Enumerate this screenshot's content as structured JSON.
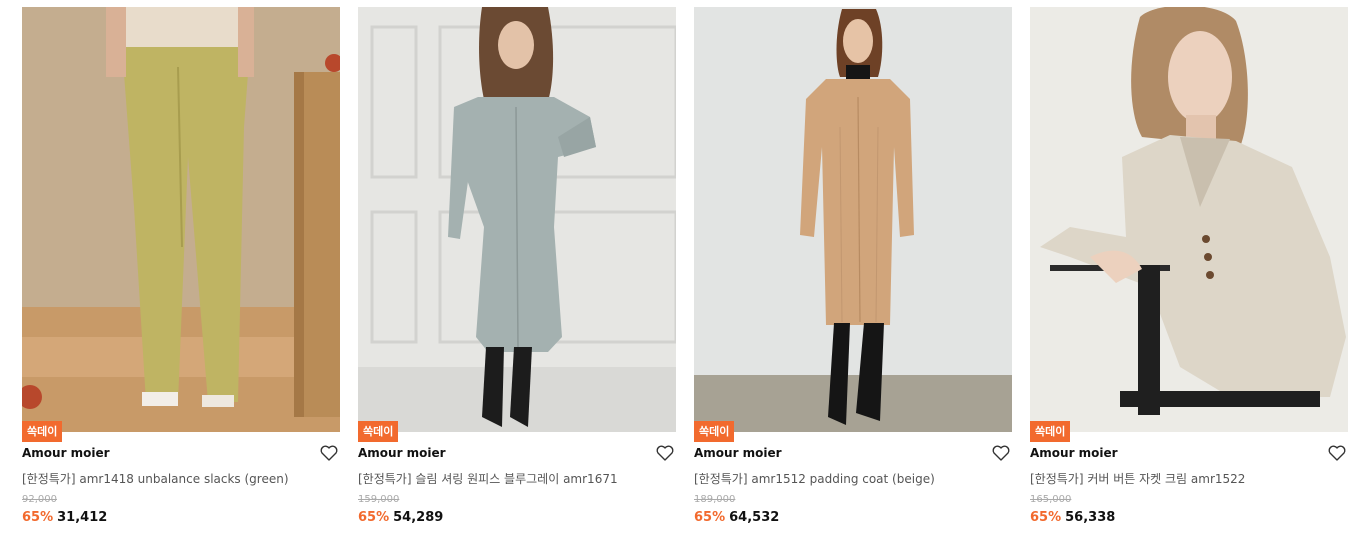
{
  "products": [
    {
      "badge": "쏙데이",
      "brand": "Amour moier",
      "title": "[한정특가] amr1418 unbalance slacks (green)",
      "original_price": "92,000",
      "discount": "65%",
      "price": "31,412",
      "wish_icon": "heart-outline-icon"
    },
    {
      "badge": "쏙데이",
      "brand": "Amour moier",
      "title": "[한정특가] 슬림 셔링 원피스 블루그레이 amr1671",
      "original_price": "159,000",
      "discount": "65%",
      "price": "54,289",
      "wish_icon": "heart-outline-icon"
    },
    {
      "badge": "쏙데이",
      "brand": "Amour moier",
      "title": "[한정특가] amr1512 padding coat (beige)",
      "original_price": "189,000",
      "discount": "65%",
      "price": "64,532",
      "wish_icon": "heart-outline-icon"
    },
    {
      "badge": "쏙데이",
      "brand": "Amour moier",
      "title": "[한정특가] 커버 버튼 자켓 크림 amr1522",
      "original_price": "165,000",
      "discount": "65%",
      "price": "56,338",
      "wish_icon": "heart-outline-icon"
    }
  ],
  "colors": {
    "accent": "#f26a2e",
    "text": "#111111",
    "muted": "#aaaaaa"
  }
}
